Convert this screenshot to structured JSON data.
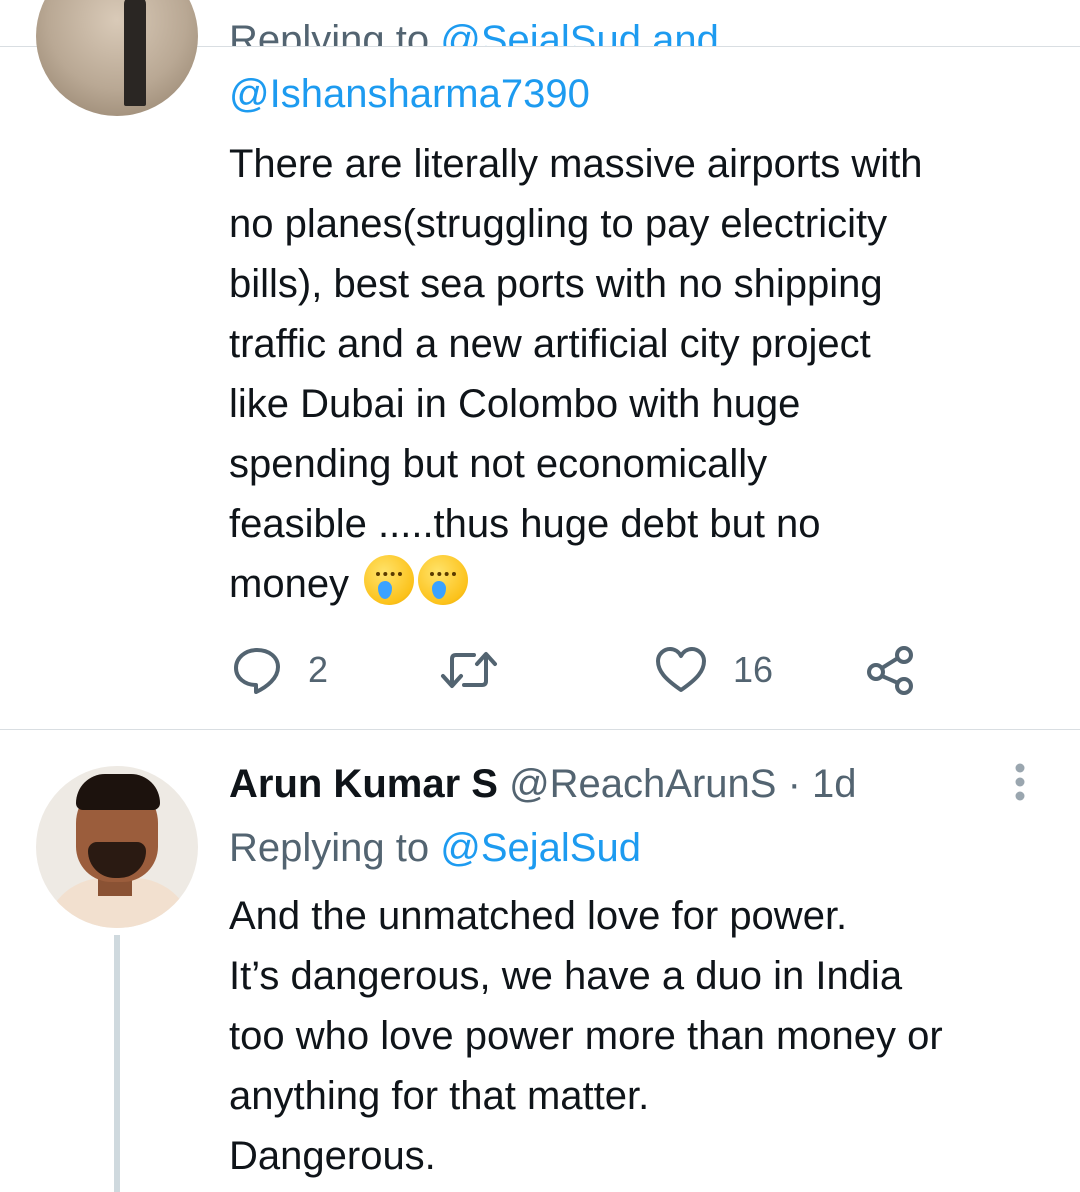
{
  "tweet1": {
    "replying_prefix": "Replying to",
    "replying_handle_cut": "@SejalSud and",
    "replying_handle": "@Ishansharma7390",
    "text": "There are literally massive airports with\nno planes(struggling to pay electricity\nbills), best sea ports with no shipping\ntraffic and a new artificial city project\nlike Dubai in Colombo with huge\nspending but not economically\nfeasible .....thus huge debt but no\nmoney",
    "emoji": "crying-face-emoji",
    "actions": {
      "reply_count": "2",
      "retweet_count": "",
      "like_count": "16"
    }
  },
  "tweet2": {
    "author_name": "Arun Kumar S",
    "author_handle": "@ReachArunS",
    "separator": "·",
    "timestamp": "1d",
    "replying_prefix": "Replying to",
    "replying_handle": "@SejalSud",
    "lines": [
      "And the unmatched love for power.",
      "It’s dangerous, we have a duo in India",
      "too who love power more than money or",
      "anything for that matter.",
      "Dangerous."
    ]
  },
  "icons": [
    "reply-icon",
    "retweet-icon",
    "like-icon",
    "share-icon",
    "more-options-icon"
  ],
  "colors": {
    "text": "#0f1419",
    "secondary": "#536471",
    "link": "#1d9bf0",
    "divider": "#d9dee2"
  }
}
